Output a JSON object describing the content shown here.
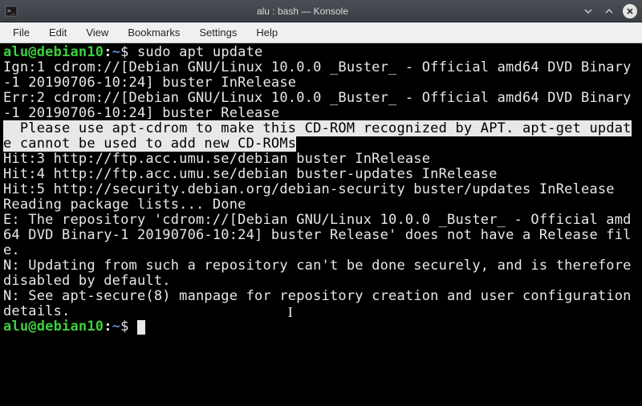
{
  "window": {
    "title": "alu : bash — Konsole"
  },
  "menubar": {
    "items": [
      "File",
      "Edit",
      "View",
      "Bookmarks",
      "Settings",
      "Help"
    ]
  },
  "prompt": {
    "user_host": "alu@debian10",
    "colon": ":",
    "path": "~",
    "symbol": "$"
  },
  "terminal": {
    "command1": "sudo apt update",
    "lines": [
      "Ign:1 cdrom://[Debian GNU/Linux 10.0.0 _Buster_ - Official amd64 DVD Binary-1 20190706-10:24] buster InRelease",
      "Err:2 cdrom://[Debian GNU/Linux 10.0.0 _Buster_ - Official amd64 DVD Binary-1 20190706-10:24] buster Release"
    ],
    "selected": "  Please use apt-cdrom to make this CD-ROM recognized by APT. apt-get update cannot be used to add new CD-ROMs",
    "lines2": [
      "Hit:3 http://ftp.acc.umu.se/debian buster InRelease",
      "Hit:4 http://ftp.acc.umu.se/debian buster-updates InRelease",
      "Hit:5 http://security.debian.org/debian-security buster/updates InRelease",
      "Reading package lists... Done",
      "E: The repository 'cdrom://[Debian GNU/Linux 10.0.0 _Buster_ - Official amd64 DVD Binary-1 20190706-10:24] buster Release' does not have a Release file.",
      "N: Updating from such a repository can't be done securely, and is therefore disabled by default.",
      "N: See apt-secure(8) manpage for repository creation and user configuration details."
    ]
  }
}
